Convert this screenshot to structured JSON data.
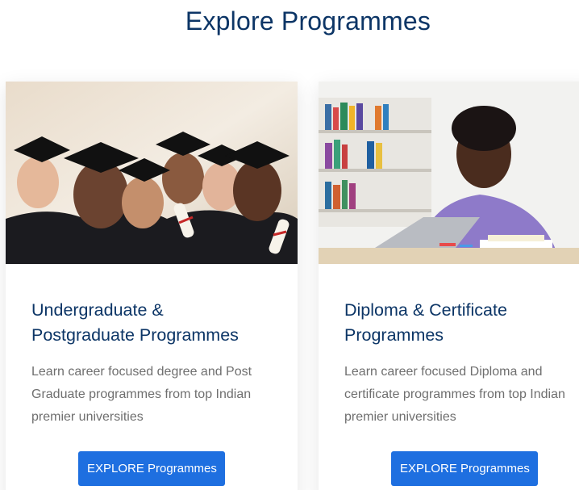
{
  "section": {
    "title": "Explore Programmes"
  },
  "cards": [
    {
      "image_alt": "graduates-group-photo",
      "title_line1": "Undergraduate &",
      "title_line2": "Postgraduate Programmes",
      "description": "Learn career focused degree and Post Graduate programmes from top Indian premier universities",
      "button_label": "EXPLORE Programmes"
    },
    {
      "image_alt": "student-studying-at-desk",
      "title_line1": "Diploma & Certificate",
      "title_line2": "Programmes",
      "description": "Learn career focused Diploma and certificate programmes from top Indian premier universities",
      "button_label": "EXPLORE Programmes"
    }
  ],
  "colors": {
    "heading": "#0c3566",
    "body_text": "#6f6f6f",
    "button": "#1e6fe0"
  }
}
